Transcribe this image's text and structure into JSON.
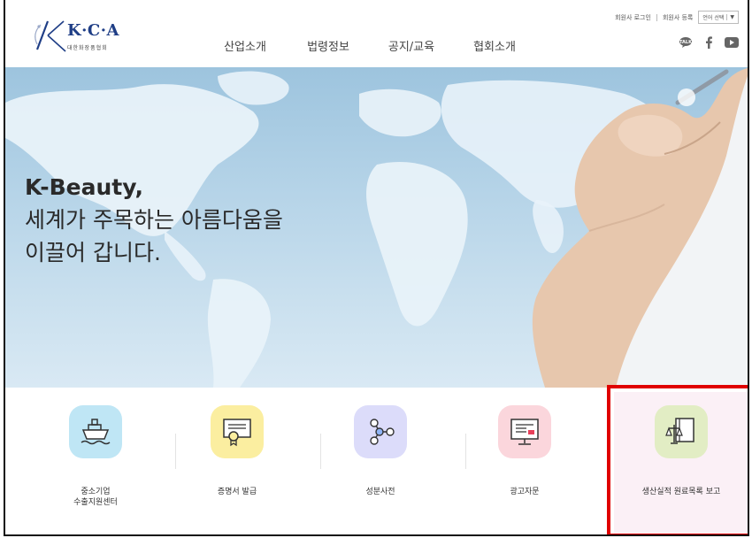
{
  "header": {
    "logo_text": "K·C·A",
    "logo_sub": "대한화장품협회",
    "nav": [
      "산업소개",
      "법령정보",
      "공지/교육",
      "협회소개"
    ],
    "util": {
      "login": "회원사 로그인",
      "register": "회원사 등록",
      "lang_label": "언어 선택",
      "lang_arrow": "▼"
    },
    "sns": [
      "talk-icon",
      "facebook-icon",
      "youtube-icon"
    ]
  },
  "hero": {
    "line1": "K-Beauty,",
    "line2": "세계가 주목하는 아름다움을",
    "line3": "이끌어 갑니다."
  },
  "quick_menu": [
    {
      "label_1": "중소기업",
      "label_2": "수출지원센터",
      "icon": "ship-icon",
      "bg": "#bfe6f5"
    },
    {
      "label_1": "증명서 발급",
      "label_2": "",
      "icon": "certificate-icon",
      "bg": "#fbeea0"
    },
    {
      "label_1": "성분사전",
      "label_2": "",
      "icon": "molecule-icon",
      "bg": "#dcdcfa"
    },
    {
      "label_1": "광고자문",
      "label_2": "",
      "icon": "monitor-icon",
      "bg": "#fbd6dc"
    },
    {
      "label_1": "생산실적 원료목록 보고",
      "label_2": "",
      "icon": "scale-book-icon",
      "bg": "#e2edc4"
    }
  ],
  "colors": {
    "brand": "#1f3e86",
    "highlight": "#e00000"
  }
}
